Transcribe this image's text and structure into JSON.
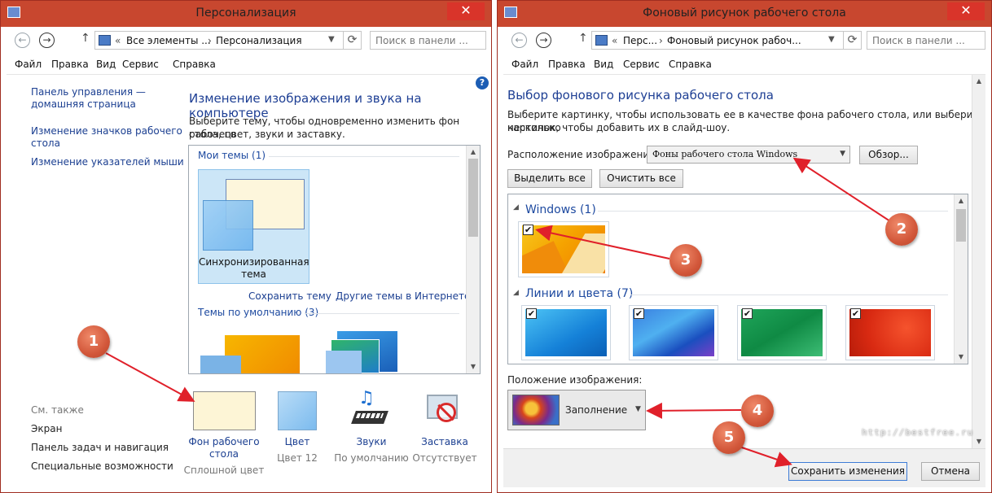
{
  "left_window": {
    "title": "Персонализация",
    "close_glyph": "✕",
    "address": {
      "chevron": "«",
      "crumb1": "Все элементы ...",
      "sep": "›",
      "crumb2": "Персонализация"
    },
    "search_placeholder": "Поиск в панели ...",
    "menu": [
      "Файл",
      "Правка",
      "Вид",
      "Сервис",
      "Справка"
    ],
    "sidebar": {
      "home_line1": "Панель управления —",
      "home_line2": "домашняя страница",
      "icons_line1": "Изменение значков рабочего",
      "icons_line2": "стола",
      "pointers": "Изменение указателей мыши"
    },
    "see_also": {
      "heading": "См. также",
      "items": [
        "Экран",
        "Панель задач и навигация",
        "Специальные возможности"
      ]
    },
    "heading": "Изменение изображения и звука на компьютере",
    "subtitle_line1": "Выберите тему, чтобы одновременно изменить фон рабочего",
    "subtitle_line2": "стола, цвет, звуки и заставку.",
    "help_glyph": "?",
    "my_themes": {
      "header": "Мои темы (1)",
      "theme_line1": "Синхронизированная",
      "theme_line2": "тема"
    },
    "save_theme_link": "Сохранить тему",
    "more_themes_link": "Другие темы в Интернете",
    "default_themes_header": "Темы по умолчанию (3)",
    "bottom": [
      {
        "line1": "Фон рабочего",
        "line2": "стола",
        "value": "Сплошной цвет"
      },
      {
        "line1": "Цвет",
        "line2": "",
        "value": "Цвет 12"
      },
      {
        "line1": "Звуки",
        "line2": "",
        "value": "По умолчанию"
      },
      {
        "line1": "Заставка",
        "line2": "",
        "value": "Отсутствует"
      }
    ]
  },
  "right_window": {
    "title": "Фоновый рисунок рабочего стола",
    "close_glyph": "✕",
    "address": {
      "chevron": "«",
      "crumb1": "Перс...",
      "sep": "›",
      "crumb2": "Фоновый рисунок рабоч..."
    },
    "search_placeholder": "Поиск в панели ...",
    "menu": [
      "Файл",
      "Правка",
      "Вид",
      "Сервис",
      "Справка"
    ],
    "heading": "Выбор фонового рисунка рабочего стола",
    "desc_line1": "Выберите картинку, чтобы использовать ее в качестве фона рабочего стола, или выберите несколько",
    "desc_line2": "картинок, чтобы добавить их в слайд-шоу.",
    "location_label": "Расположение изображения:",
    "location_value": "Фоны рабочего стола Windows",
    "browse_button": "Обзор...",
    "select_all_button": "Выделить все",
    "clear_all_button": "Очистить все",
    "group1": "Windows (1)",
    "group2": "Линии и цвета (7)",
    "collapse_glyph": "◢",
    "check_glyph": "✔",
    "position_label": "Положение изображения:",
    "position_value": "Заполнение",
    "save_button": "Сохранить изменения",
    "cancel_button": "Отмена"
  },
  "callouts": [
    "1",
    "2",
    "3",
    "4",
    "5"
  ],
  "watermark": "http://bestfree.ru",
  "colors": {
    "titlebar": "#c8472f",
    "link": "#1b3f91",
    "heading": "#1e3f94",
    "badge": "#d2573a",
    "arrow": "#e0202a"
  }
}
